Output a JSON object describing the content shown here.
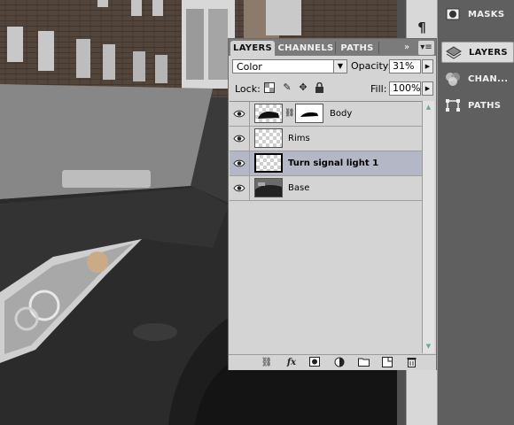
{
  "dock": {
    "para_icon": "paragraph-icon",
    "items": [
      {
        "label": "MASKS",
        "icon": "masks-icon",
        "active": false
      },
      {
        "label": "LAYERS",
        "icon": "layers-icon",
        "active": true
      },
      {
        "label": "CHAN...",
        "icon": "channels-icon",
        "active": false
      },
      {
        "label": "PATHS",
        "icon": "paths-icon",
        "active": false
      }
    ]
  },
  "panel": {
    "tabs": [
      "LAYERS",
      "CHANNELS",
      "PATHS"
    ],
    "active_tab": "LAYERS",
    "collapse_glyph": "»",
    "menu_glyph": "▾≡",
    "blend_mode": "Color",
    "opacity_label": "Opacity:",
    "opacity": "31%",
    "lock_label": "Lock:",
    "fill_label": "Fill:",
    "fill": "100%",
    "layers": [
      {
        "name": "Body",
        "selected": false,
        "visible": true,
        "has_mask": true
      },
      {
        "name": "Rims",
        "selected": false,
        "visible": true,
        "has_mask": false
      },
      {
        "name": "Turn signal light 1",
        "selected": true,
        "visible": true,
        "has_mask": false
      },
      {
        "name": "Base",
        "selected": false,
        "visible": true,
        "has_mask": false
      }
    ],
    "bottom_icons": [
      "link-layers-icon",
      "fx-icon",
      "add-mask-icon",
      "adjustment-layer-icon",
      "new-group-icon",
      "new-layer-icon",
      "trash-icon"
    ],
    "fx_label": "fx"
  },
  "colors": {
    "panel_bg": "#d4d4d4",
    "tabbar_bg": "#7b7b7b",
    "selected_row": "#b4b8c6",
    "dock_bg": "#5f5f5f"
  }
}
